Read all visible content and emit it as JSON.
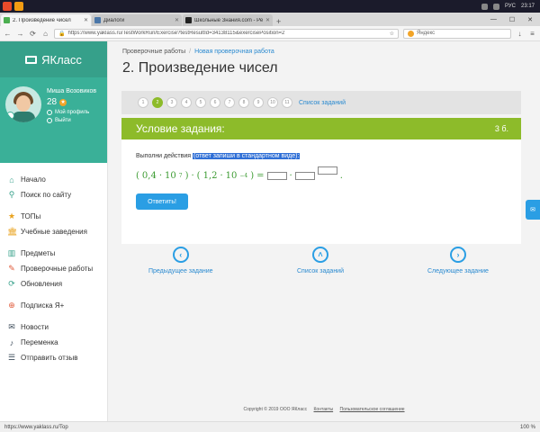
{
  "taskbar": {
    "tray_lang": "РУС",
    "clock": "23:17"
  },
  "browser": {
    "tabs": [
      {
        "label": "2. Произведение чисел",
        "active": true,
        "fav_color": "#4caf50"
      },
      {
        "label": "Диалоги",
        "active": false,
        "fav_color": "#4a76a8"
      },
      {
        "label": "Школьные Знания.com - Ре",
        "active": false,
        "fav_color": "#222222"
      }
    ],
    "url": "https://www.yaklass.ru/TestWorkRun/Exercise?testResultId=34138115&exercisePosition=2",
    "search_placeholder": "Яндекс"
  },
  "sidebar": {
    "brand": "ЯКласс",
    "profile": {
      "name": "Миша Возовиков",
      "score": "28",
      "my_profile": "Мой профиль",
      "logout": "Выйти"
    },
    "groups": [
      [
        {
          "label": "Начало",
          "icon": "home-icon",
          "glyph": "⌂",
          "tone": ""
        },
        {
          "label": "Поиск по сайту",
          "icon": "search-icon",
          "glyph": "⚲",
          "tone": ""
        }
      ],
      [
        {
          "label": "ТОПы",
          "icon": "star-icon",
          "glyph": "★",
          "tone": "gold"
        },
        {
          "label": "Учебные заведения",
          "icon": "school-icon",
          "glyph": "🏛",
          "tone": "gold"
        }
      ],
      [
        {
          "label": "Предметы",
          "icon": "books-icon",
          "glyph": "▥",
          "tone": ""
        },
        {
          "label": "Проверочные работы",
          "icon": "tests-icon",
          "glyph": "✎",
          "tone": "red"
        },
        {
          "label": "Обновления",
          "icon": "refresh-icon",
          "glyph": "⟳",
          "tone": ""
        }
      ],
      [
        {
          "label": "Подписка Я+",
          "icon": "subscription-icon",
          "glyph": "⊕",
          "tone": "red"
        }
      ],
      [
        {
          "label": "Новости",
          "icon": "megaphone-icon",
          "glyph": "✉",
          "tone": "dark"
        },
        {
          "label": "Переменка",
          "icon": "bell-icon",
          "glyph": "♪",
          "tone": "dark"
        },
        {
          "label": "Отправить отзыв",
          "icon": "feedback-icon",
          "glyph": "☰",
          "tone": "dark"
        }
      ]
    ]
  },
  "main": {
    "breadcrumb": {
      "root": "Проверочные работы",
      "current": "Новая проверочная работа"
    },
    "title": "2. Произведение чисел",
    "pager": {
      "pages": [
        "1",
        "2",
        "3",
        "4",
        "5",
        "6",
        "7",
        "8",
        "9",
        "10",
        "11"
      ],
      "current": "2",
      "list_link": "Список заданий"
    },
    "task": {
      "header": "Условие задания:",
      "points": "3 б.",
      "instruction": "Выполни действия",
      "hint": "(ответ запиши в стандартном виде):",
      "formula": {
        "a_mantissa": "0,4",
        "a_base": "10",
        "a_exp": "7",
        "b_mantissa": "1,2",
        "b_base": "10",
        "b_exp": "−4"
      },
      "submit": "Ответить!"
    },
    "nav": {
      "prev": "Предыдущее задание",
      "list": "Список заданий",
      "next": "Следующее задание"
    },
    "footer": {
      "copyright": "Copyright © 2019 ООО ЯКласс",
      "contacts": "Контакты",
      "agreement": "Пользовательское соглашение"
    }
  },
  "status": {
    "link": "https://www.yaklass.ru/Top",
    "zoom": "100 %"
  }
}
